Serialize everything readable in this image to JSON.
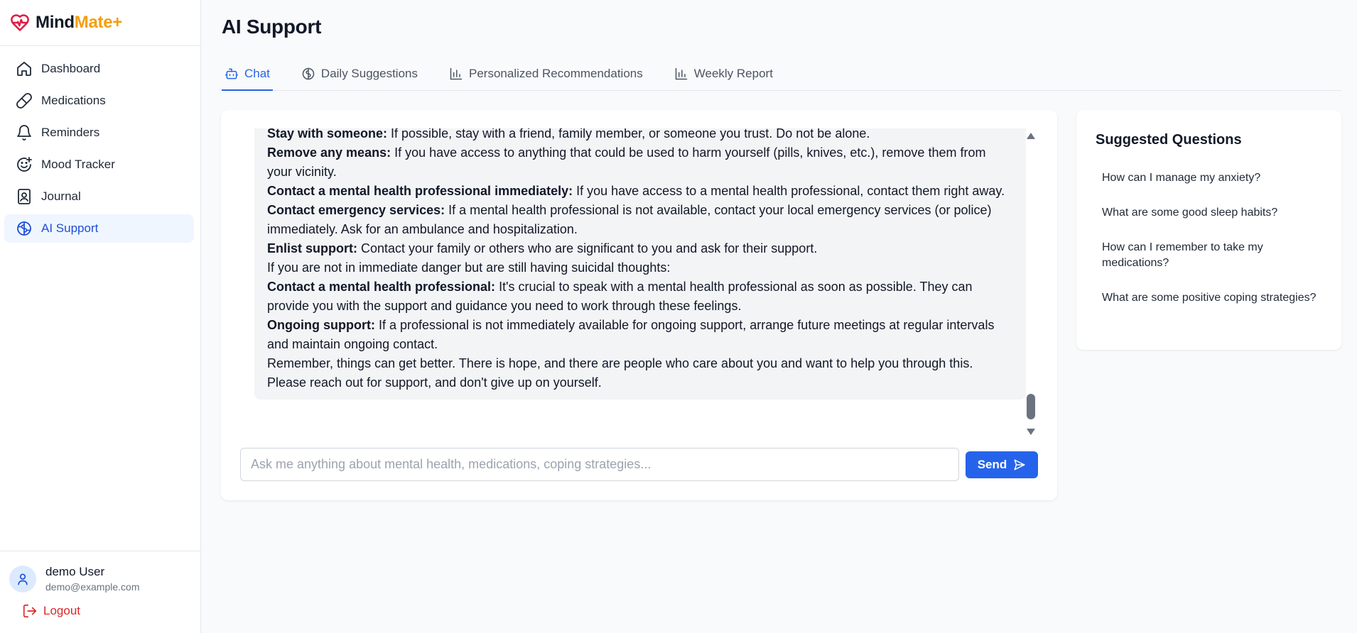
{
  "brand": {
    "name_part1": "Mind",
    "name_part2": "Mate+"
  },
  "colors": {
    "accent": "#2563eb",
    "brand_orange": "#f59e0b",
    "logout_red": "#dc2626",
    "heart_red": "#e11d48"
  },
  "sidebar": {
    "items": [
      {
        "label": "Dashboard",
        "icon": "home-icon"
      },
      {
        "label": "Medications",
        "icon": "pill-icon"
      },
      {
        "label": "Reminders",
        "icon": "bell-icon"
      },
      {
        "label": "Mood Tracker",
        "icon": "smile-icon"
      },
      {
        "label": "Journal",
        "icon": "journal-icon"
      },
      {
        "label": "AI Support",
        "icon": "brain-icon",
        "active": true
      }
    ],
    "user": {
      "name": "demo User",
      "email": "demo@example.com"
    },
    "logout_label": "Logout"
  },
  "main": {
    "title": "AI Support",
    "tabs": [
      {
        "label": "Chat",
        "icon": "bot-icon",
        "active": true
      },
      {
        "label": "Daily Suggestions",
        "icon": "brain-icon"
      },
      {
        "label": "Personalized Recommendations",
        "icon": "bar-chart-icon"
      },
      {
        "label": "Weekly Report",
        "icon": "bar-chart-icon"
      }
    ]
  },
  "chat": {
    "message": {
      "p1_bold": "Stay with someone:",
      "p1_text": " If possible, stay with a friend, family member, or someone you trust. Do not be alone.",
      "p2_bold": "Remove any means:",
      "p2_text": " If you have access to anything that could be used to harm yourself (pills, knives, etc.), remove them from your vicinity.",
      "p3_bold": "Contact a mental health professional immediately:",
      "p3_text": " If you have access to a mental health professional, contact them right away.",
      "p4_bold": "Contact emergency services:",
      "p4_text": " If a mental health professional is not available, contact your local emergency services (or police) immediately. Ask for an ambulance and hospitalization.",
      "p5_bold": "Enlist support:",
      "p5_text": " Contact your family or others who are significant to you and ask for their support.",
      "p6_text": "If you are not in immediate danger but are still having suicidal thoughts:",
      "p7_bold": "Contact a mental health professional:",
      "p7_text": " It's crucial to speak with a mental health professional as soon as possible. They can provide you with the support and guidance you need to work through these feelings.",
      "p8_bold": "Ongoing support:",
      "p8_text": " If a professional is not immediately available for ongoing support, arrange future meetings at regular intervals and maintain ongoing contact.",
      "p9_text": "Remember, things can get better. There is hope, and there are people who care about you and want to help you through this. Please reach out for support, and don't give up on yourself."
    },
    "input": {
      "placeholder": "Ask me anything about mental health, medications, coping strategies...",
      "value": ""
    },
    "send_label": "Send",
    "scroll_position": 0.97
  },
  "suggested": {
    "title": "Suggested Questions",
    "items": [
      "How can I manage my anxiety?",
      "What are some good sleep habits?",
      "How can I remember to take my medications?",
      "What are some positive coping strategies?"
    ]
  }
}
